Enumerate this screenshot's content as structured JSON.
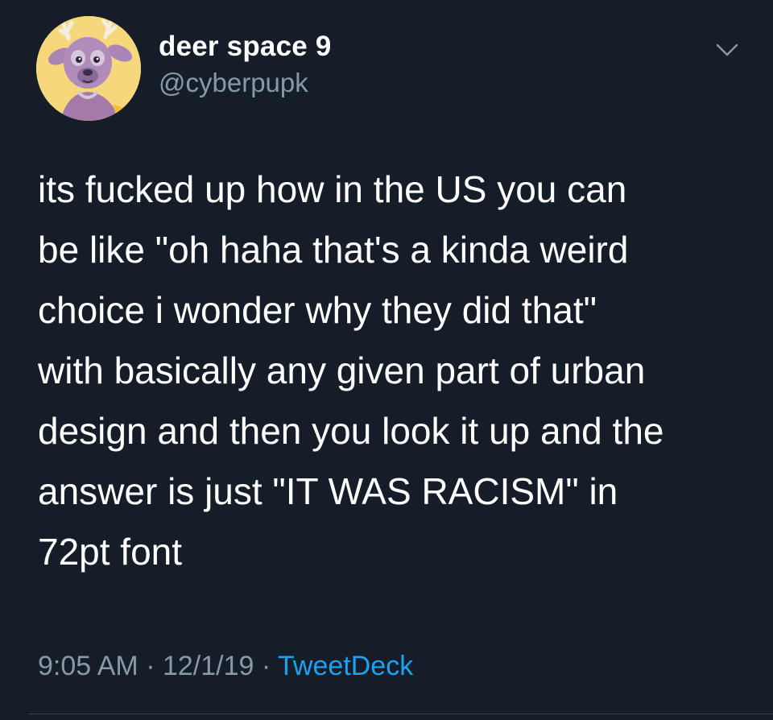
{
  "author": {
    "display_name": "deer space 9",
    "handle": "@cyberpupk",
    "avatar_icon": "deer-character-avatar"
  },
  "menu_icon": "chevron-down-icon",
  "tweet": {
    "lines": [
      "its fucked up how in the US you can",
      "be like \"oh haha that's a kinda weird",
      "choice i wonder why they did that\"",
      "with basically any given part of urban",
      "design and then you look it up and the",
      "answer is just \"IT WAS RACISM\" in",
      "72pt font"
    ]
  },
  "meta": {
    "time": "9:05 AM",
    "separator": " · ",
    "date": "12/1/19",
    "source": "TweetDeck"
  },
  "colors": {
    "background": "#151d28",
    "text": "#ffffff",
    "secondary": "#8899a6",
    "link": "#1da1f2",
    "avatar_bg": "#f6d77b"
  }
}
